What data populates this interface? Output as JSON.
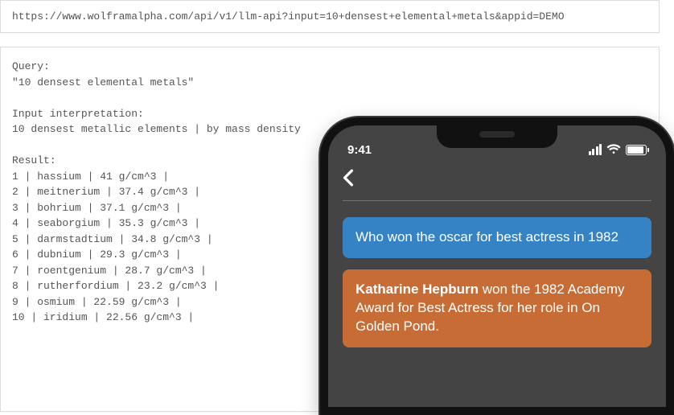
{
  "url": "https://www.wolframalpha.com/api/v1/llm-api?input=10+densest+elemental+metals&appid=DEMO",
  "api_response": {
    "query_label": "Query:",
    "query_value": "\"10 densest elemental metals\"",
    "interp_label": "Input interpretation:",
    "interp_value": "10 densest metallic elements | by mass density",
    "result_label": "Result:",
    "rows": [
      "1 | hassium | 41 g/cm^3 |",
      "2 | meitnerium | 37.4 g/cm^3 |",
      "3 | bohrium | 37.1 g/cm^3 |",
      "4 | seaborgium | 35.3 g/cm^3 |",
      "5 | darmstadtium | 34.8 g/cm^3 |",
      "6 | dubnium | 29.3 g/cm^3 |",
      "7 | roentgenium | 28.7 g/cm^3 |",
      "8 | rutherfordium | 23.2 g/cm^3 |",
      "9 | osmium | 22.59 g/cm^3 |",
      "10 | iridium | 22.56 g/cm^3 |"
    ]
  },
  "phone": {
    "time": "9:41",
    "chat": {
      "user_message": "Who won the oscar for best actress in 1982",
      "answer_bold": "Katharine Hepburn",
      "answer_rest": " won the 1982 Academy Award for Best Actress for her role in On Golden Pond."
    }
  }
}
